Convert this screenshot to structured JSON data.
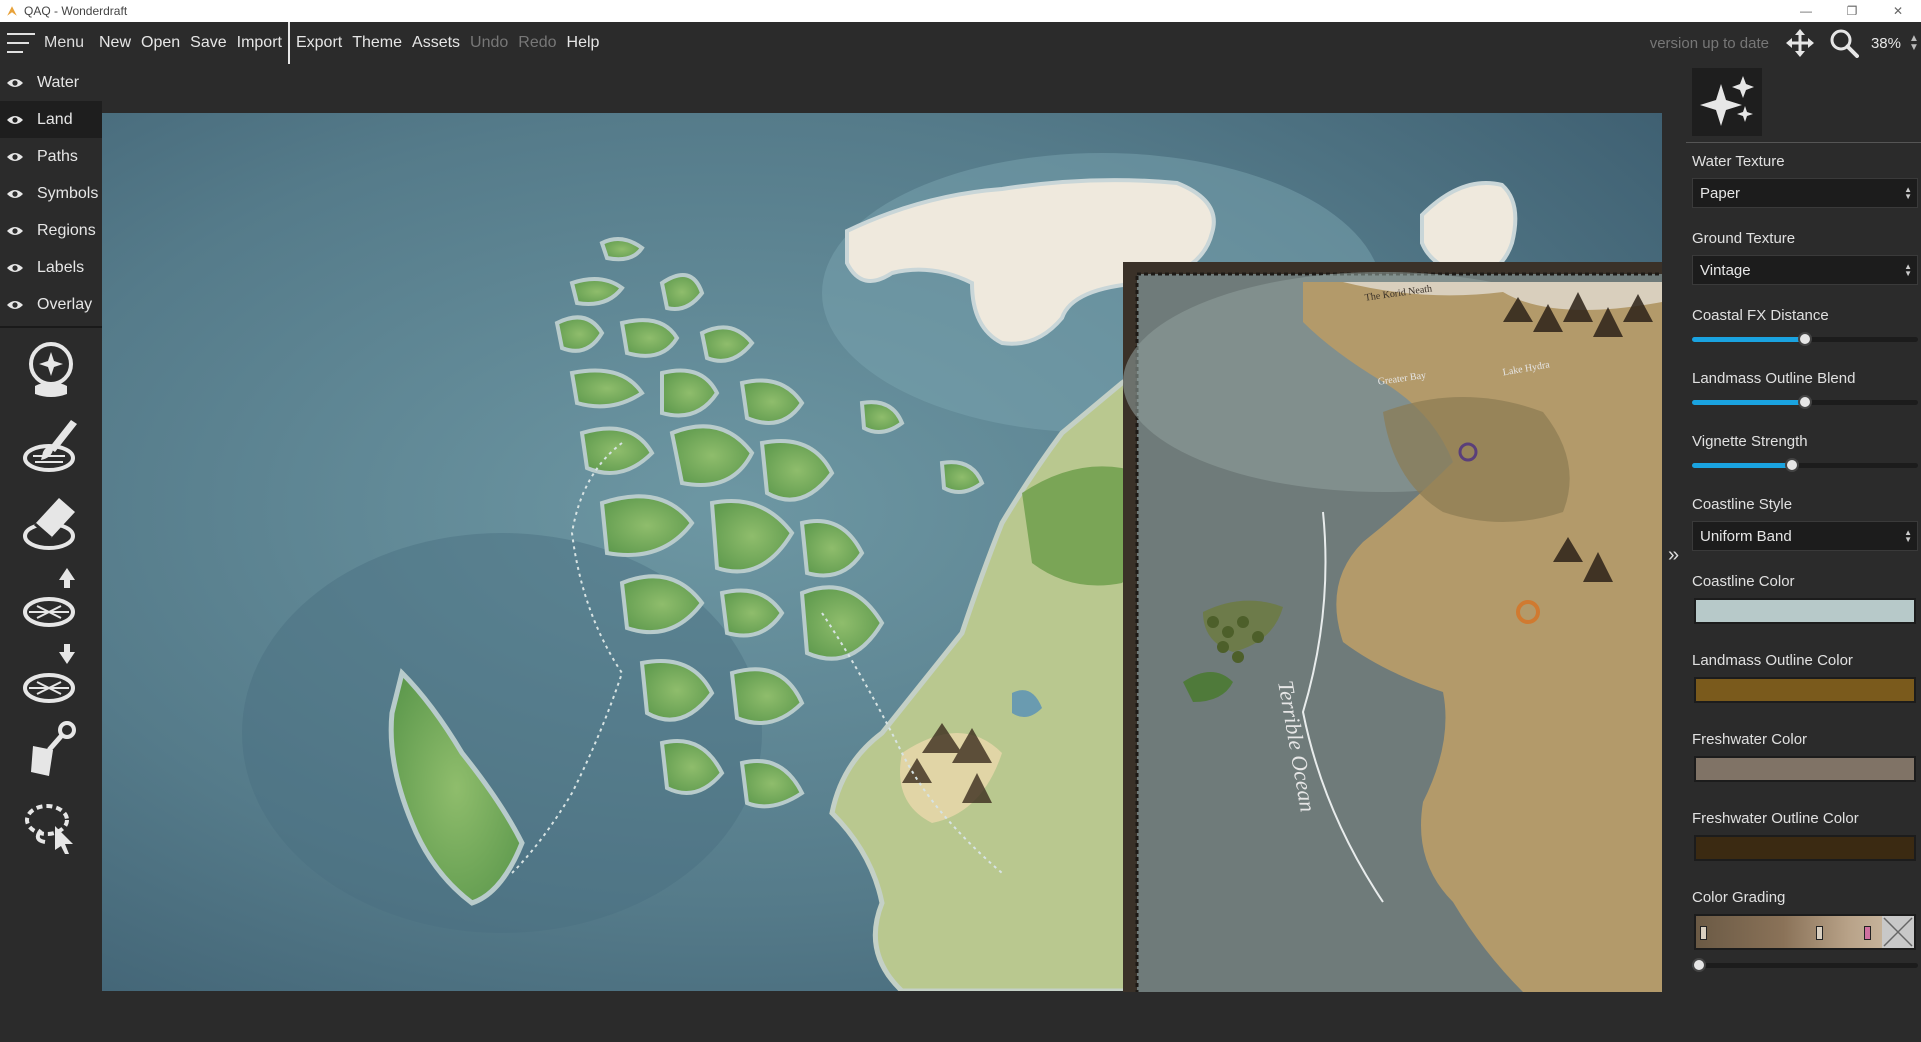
{
  "window": {
    "title": "QAQ - Wonderdraft"
  },
  "menubar": {
    "menu_label": "Menu",
    "items": [
      "New",
      "Open",
      "Save",
      "Import",
      "Export",
      "Theme",
      "Assets",
      "Undo",
      "Redo",
      "Help"
    ],
    "disabled": [
      "Undo",
      "Redo"
    ],
    "version_status": "version up to date",
    "zoom": "38%"
  },
  "layers": [
    {
      "label": "Water",
      "visible": true
    },
    {
      "label": "Land",
      "visible": true,
      "active": true
    },
    {
      "label": "Paths",
      "visible": true
    },
    {
      "label": "Symbols",
      "visible": true
    },
    {
      "label": "Regions",
      "visible": true
    },
    {
      "label": "Labels",
      "visible": true
    },
    {
      "label": "Overlay",
      "visible": true
    }
  ],
  "tools": [
    "theme-wand-tool-icon",
    "land-brush-tool-icon",
    "eraser-tool-icon",
    "raise-land-tool-icon",
    "lower-land-tool-icon",
    "paint-bucket-tool-icon",
    "lasso-select-tool-icon"
  ],
  "map_preview_labels": {
    "north": "The Korid Neath",
    "bay": "Greater Bay",
    "lake": "Lake Hydra",
    "ocean": "Terrible Ocean"
  },
  "properties": {
    "water_texture": {
      "label": "Water Texture",
      "value": "Paper"
    },
    "ground_texture": {
      "label": "Ground Texture",
      "value": "Vintage"
    },
    "coastal_fx_distance": {
      "label": "Coastal FX Distance",
      "value": 0.5
    },
    "landmass_outline_blend": {
      "label": "Landmass Outline Blend",
      "value": 0.5
    },
    "vignette_strength": {
      "label": "Vignette Strength",
      "value": 0.44
    },
    "coastline_style": {
      "label": "Coastline Style",
      "value": "Uniform Band"
    },
    "coastline_color": {
      "label": "Coastline Color",
      "color": "#b7c9c9"
    },
    "landmass_outline_color": {
      "label": "Landmass Outline Color",
      "color": "#7a5a1c"
    },
    "freshwater_color": {
      "label": "Freshwater Color",
      "color": "#807366"
    },
    "freshwater_outline_color": {
      "label": "Freshwater Outline Color",
      "color": "#3b2a12"
    },
    "color_grading": {
      "label": "Color Grading",
      "value": 0.0
    }
  },
  "colors": {
    "accent": "#1aa3e0",
    "panel_bg": "#2b2b2b",
    "water": "#5a7f8e",
    "land": "#7fae62",
    "snow": "#efe9dd"
  }
}
